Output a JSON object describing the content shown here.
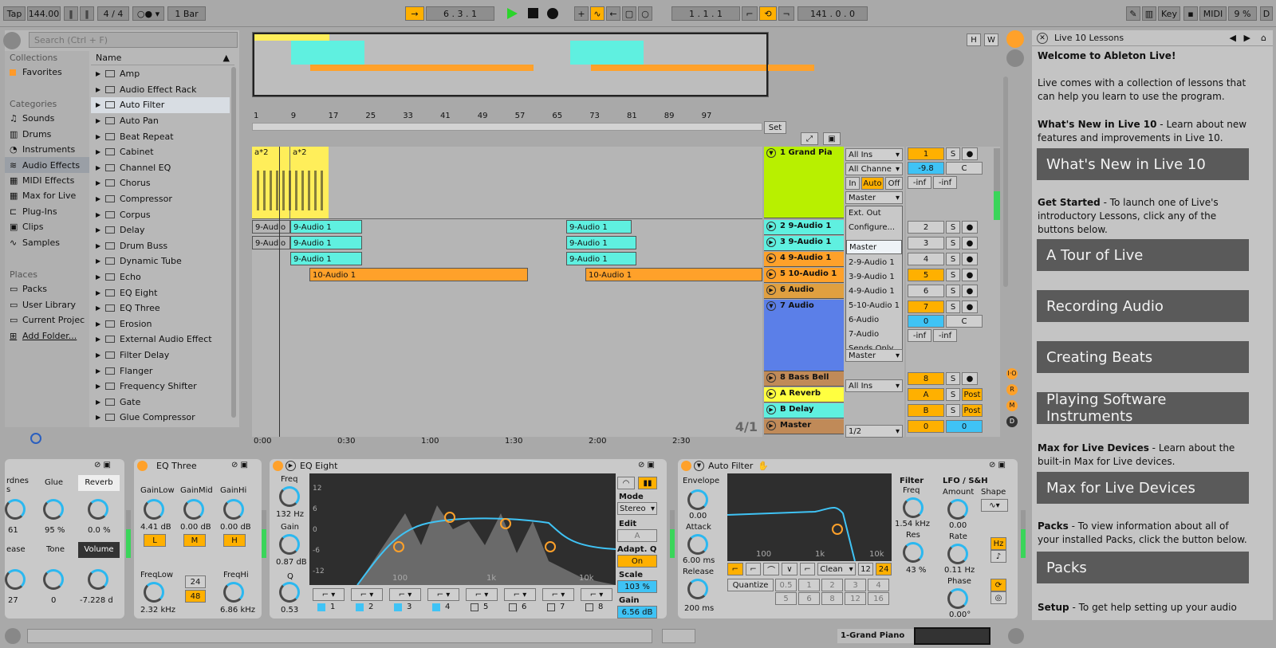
{
  "transport": {
    "tap": "Tap",
    "bpm": "144.00",
    "meter": "4 / 4",
    "quant": "1 Bar",
    "pos": "6 . 3 . 1",
    "loop_start": "1 . 1 . 1",
    "loop_len": "141 . 0 . 0",
    "key": "Key",
    "midi": "MIDI",
    "cpu": "9 %",
    "d": "D"
  },
  "browser": {
    "search_placeholder": "Search (Ctrl + F)",
    "collections": "Collections",
    "favorites": "Favorites",
    "categories": "Categories",
    "cats": [
      "Sounds",
      "Drums",
      "Instruments",
      "Audio Effects",
      "MIDI Effects",
      "Max for Live",
      "Plug-Ins",
      "Clips",
      "Samples"
    ],
    "places": "Places",
    "place_items": [
      "Packs",
      "User Library",
      "Current Projec",
      "Add Folder..."
    ],
    "name_header": "Name",
    "items": [
      "Amp",
      "Audio Effect Rack",
      "Auto Filter",
      "Auto Pan",
      "Beat Repeat",
      "Cabinet",
      "Channel EQ",
      "Chorus",
      "Compressor",
      "Corpus",
      "Delay",
      "Drum Buss",
      "Dynamic Tube",
      "Echo",
      "EQ Eight",
      "EQ Three",
      "Erosion",
      "External Audio Effect",
      "Filter Delay",
      "Flanger",
      "Frequency Shifter",
      "Gate",
      "Glue Compressor"
    ]
  },
  "arrangement": {
    "ruler": [
      "1",
      "9",
      "17",
      "25",
      "33",
      "41",
      "49",
      "57",
      "65",
      "73",
      "81",
      "89",
      "97"
    ],
    "time": [
      "0:00",
      "0:30",
      "1:00",
      "1:30",
      "2:00",
      "2:30"
    ],
    "set": "Set",
    "zoom": "4/1",
    "clips": {
      "midi": [
        "a*2",
        "a*2"
      ],
      "audio9": "9-Audio 1",
      "audio9s": "9-Audio",
      "audio10": "10-Audio 1"
    }
  },
  "tracks": [
    {
      "name": "1 Grand Pia",
      "num": "1",
      "vol": "-9.8",
      "pan": "C",
      "color": "#b8f000"
    },
    {
      "name": "2 9-Audio 1",
      "num": "2",
      "color": "#5ff0e0"
    },
    {
      "name": "3 9-Audio 1",
      "num": "3",
      "color": "#5ff0e0"
    },
    {
      "name": "4 9-Audio 1",
      "num": "4",
      "color": "#ffa12a"
    },
    {
      "name": "5 10-Audio 1",
      "num": "5",
      "color": "#ffa12a"
    },
    {
      "name": "6 Audio",
      "num": "6",
      "color": "#e0a040"
    },
    {
      "name": "7 Audio",
      "num": "7",
      "vol": "0",
      "pan": "C",
      "color": "#5b7fe8"
    },
    {
      "name": "8 Bass Bell",
      "num": "8",
      "color": "#c08a58"
    },
    {
      "name": "A Reverb",
      "num": "A",
      "post": "Post",
      "color": "#ffff40"
    },
    {
      "name": "B Delay",
      "num": "B",
      "post": "Post",
      "color": "#5ff0e0"
    },
    {
      "name": "Master",
      "num": "0",
      "vol2": "0",
      "ratio": "1/2",
      "color": "#c08a58"
    }
  ],
  "io": {
    "all_ins": "All Ins",
    "all_chan": "All Channe",
    "in": "In",
    "auto": "Auto",
    "off": "Off",
    "master": "Master",
    "inf": "-inf",
    "s": "S"
  },
  "dropdown": [
    "Ext. Out",
    "Configure...",
    "Master",
    "2-9-Audio 1",
    "3-9-Audio 1",
    "4-9-Audio 1",
    "5-10-Audio 1",
    "6-Audio",
    "7-Audio",
    "Sends Only"
  ],
  "lessons": {
    "title": "Live 10 Lessons",
    "welcome": "Welcome to Ableton Live!",
    "p1": "Live comes with a collection of lessons that can help you learn to use the program.",
    "p2a": "What's New in Live 10",
    "p2b": " - Learn about new features and improvements in Live 10.",
    "b1": "What's New in Live 10",
    "p3a": "Get Started",
    "p3b": " - To launch one of Live's introductory Lessons, click any of the buttons below.",
    "b2": "A Tour of Live",
    "b3": "Recording Audio",
    "b4": "Creating Beats",
    "b5": "Playing Software Instruments",
    "p4a": "Max for Live Devices",
    "p4b": " - Learn about the built-in Max for Live devices.",
    "b6": "Max for Live Devices",
    "p5a": "Packs",
    "p5b": " - To view information about all of your installed Packs, click the button below.",
    "b7": "Packs",
    "p6a": "Setup",
    "p6b": " - To get help setting up your audio"
  },
  "devices": {
    "glue": {
      "l1": "rdnes\ns",
      "glue": "Glue",
      "reverb": "Reverb",
      "v1": "61",
      "v2": "95 %",
      "v3": "0.0 %",
      "ease": "ease",
      "tone": "Tone",
      "volume": "Volume",
      "v4": "27",
      "v5": "0",
      "v6": "-7.228 d"
    },
    "eq3": {
      "title": "EQ Three",
      "gl": "GainLow",
      "gm": "GainMid",
      "gh": "GainHi",
      "vl": "4.41 dB",
      "vm": "0.00 dB",
      "vh": "0.00 dB",
      "L": "L",
      "M": "M",
      "H": "H",
      "fl": "FreqLow",
      "fh": "FreqHi",
      "f1": "2.32 kHz",
      "f2": "6.86 kHz",
      "n24": "24",
      "n48": "48"
    },
    "eq8": {
      "title": "EQ Eight",
      "freq": "Freq",
      "fv": "132 Hz",
      "gain": "Gain",
      "gv": "0.87 dB",
      "q": "Q",
      "qv": "0.53",
      "mode": "Mode",
      "stereo": "Stereo",
      "edit": "Edit",
      "a": "A",
      "adapt": "Adapt. Q",
      "on": "On",
      "scale": "Scale",
      "sv": "103 %",
      "gain2": "Gain",
      "g2v": "6.56 dB",
      "db": [
        "12",
        "6",
        "0",
        "-6",
        "-12"
      ],
      "hz": [
        "100",
        "1k",
        "10k"
      ],
      "bands": [
        "1",
        "2",
        "3",
        "4",
        "5",
        "6",
        "7",
        "8"
      ]
    },
    "af": {
      "title": "Auto Filter",
      "env": "Envelope",
      "ev": "0.00",
      "attack": "Attack",
      "av": "6.00 ms",
      "release": "Release",
      "rv": "200 ms",
      "filter": "Filter",
      "freq": "Freq",
      "fv": "1.54 kHz",
      "res": "Res",
      "resv": "43 %",
      "lfo": "LFO / S&H",
      "amount": "Amount",
      "amv": "0.00",
      "shape": "Shape",
      "rate": "Rate",
      "ratev": "0.11 Hz",
      "phase": "Phase",
      "pv": "0.00°",
      "hz": "Hz",
      "clean": "Clean",
      "n12": "12",
      "n24": "24",
      "quant": "Quantize",
      "qv": [
        "0.5",
        "1",
        "2",
        "3",
        "4",
        "5",
        "6",
        "8",
        "12",
        "16"
      ],
      "axis": [
        "100",
        "1k",
        "10k"
      ]
    }
  },
  "status": {
    "track": "1-Grand Piano"
  }
}
